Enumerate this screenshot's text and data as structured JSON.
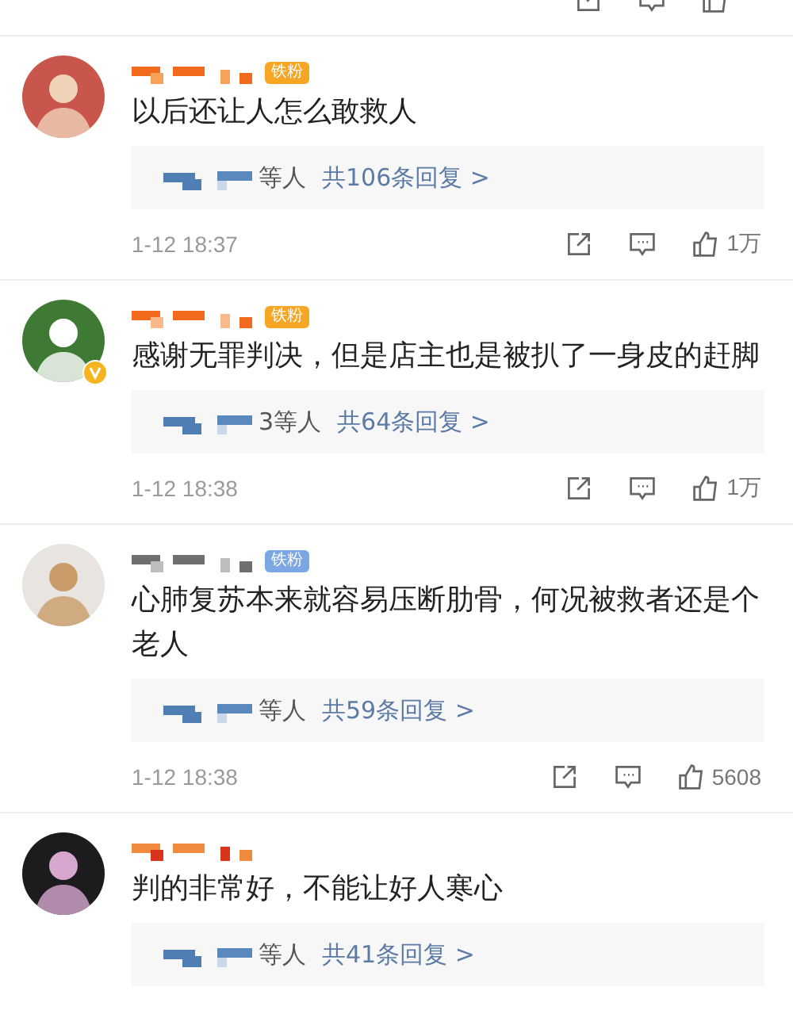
{
  "comments": [
    {
      "badge": {
        "text": "铁粉",
        "color": "#f5a623"
      },
      "verified": false,
      "text": "以后还让人怎么敢救人",
      "reply_people": "等人",
      "reply_count": "共106条回复 >",
      "time": "1-12 18:37",
      "likes": "1万"
    },
    {
      "badge": {
        "text": "铁粉",
        "color": "#f5a623"
      },
      "verified": true,
      "text": "感谢无罪判决，但是店主也是被扒了一身皮的赶脚",
      "reply_people": "3等人",
      "reply_count": "共64条回复 >",
      "time": "1-12 18:38",
      "likes": "1万"
    },
    {
      "badge": {
        "text": "铁粉",
        "color": "#7ba7e3"
      },
      "verified": false,
      "text": "心肺复苏本来就容易压断肋骨，何况被救者还是个老人",
      "reply_people": "等人",
      "reply_count": "共59条回复 >",
      "time": "1-12 18:38",
      "likes": "5608"
    },
    {
      "verified": false,
      "text": "判的非常好，不能让好人寒心",
      "reply_people": "等人",
      "reply_count": "共41条回复 >"
    }
  ]
}
